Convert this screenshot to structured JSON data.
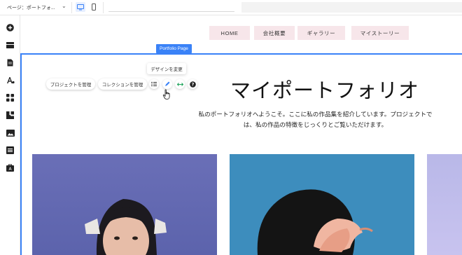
{
  "topbar": {
    "page_select_label": "ページ：ポートフォ...",
    "device_desktop_icon": "desktop-icon",
    "device_mobile_icon": "mobile-icon"
  },
  "leftrail": {
    "icons": [
      "add-icon",
      "menu-icon",
      "pages-icon",
      "design-icon",
      "apps-icon",
      "addons-icon",
      "media-icon",
      "cms-icon",
      "business-icon"
    ]
  },
  "nav": {
    "items": [
      "HOME",
      "会社概要",
      "ギャラリー",
      "マイストーリー"
    ]
  },
  "section": {
    "tag": "Portfolio Page"
  },
  "toolbar": {
    "manage_projects": "プロジェクトを管理",
    "manage_collections": "コレクションを管理",
    "tooltip": "デザインを変更"
  },
  "hero": {
    "title": "マイポートフォリオ",
    "body": "私のポートフォリオへようこそ。ここに私の作品集を紹介しています。プロジェクトでは、私の作品の特徴をじっくりとご覧いただけます。"
  },
  "colors": {
    "accent": "#3a82f7",
    "nav_bg": "#f7e6ea",
    "card1": "#6c70b5",
    "card2": "#3b8bbb",
    "card3": "#c1bfeb"
  }
}
